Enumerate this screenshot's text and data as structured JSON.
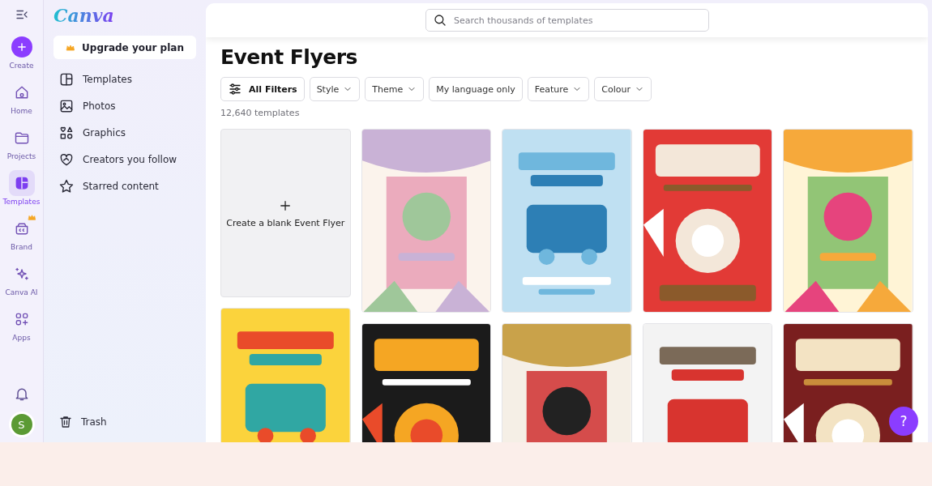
{
  "rail": {
    "items": [
      {
        "label": "Create",
        "kind": "create",
        "selected": false
      },
      {
        "label": "Home",
        "kind": "nav",
        "selected": false
      },
      {
        "label": "Projects",
        "kind": "nav",
        "selected": false
      },
      {
        "label": "Templates",
        "kind": "nav",
        "selected": true
      },
      {
        "label": "Brand",
        "kind": "nav",
        "selected": false,
        "premium": true
      },
      {
        "label": "Canva AI",
        "kind": "nav",
        "selected": false
      },
      {
        "label": "Apps",
        "kind": "nav",
        "selected": false
      }
    ],
    "avatar": "S"
  },
  "side_panel": {
    "logo": "Canva",
    "upgrade": "Upgrade your plan",
    "items": [
      {
        "label": "Templates"
      },
      {
        "label": "Photos"
      },
      {
        "label": "Graphics"
      },
      {
        "label": "Creators you follow"
      },
      {
        "label": "Starred content"
      }
    ],
    "trash": "Trash"
  },
  "search": {
    "placeholder": "Search thousands of templates"
  },
  "title": "Event Flyers",
  "filters": [
    {
      "label": "All Filters",
      "kind": "all",
      "dropdown": false
    },
    {
      "label": "Style",
      "kind": "plain",
      "dropdown": true
    },
    {
      "label": "Theme",
      "kind": "plain",
      "dropdown": true
    },
    {
      "label": "My language only",
      "kind": "plain",
      "dropdown": false
    },
    {
      "label": "Feature",
      "kind": "plain",
      "dropdown": true
    },
    {
      "label": "Colour",
      "kind": "plain",
      "dropdown": true
    }
  ],
  "count": "12,640 templates",
  "grid": [
    [
      {
        "kind": "blank",
        "label": "Create a blank Event Flyer"
      },
      {
        "kind": "picture"
      }
    ],
    [
      {
        "kind": "picture"
      },
      {
        "kind": "picture"
      }
    ],
    [
      {
        "kind": "picture"
      },
      {
        "kind": "picture"
      }
    ],
    [
      {
        "kind": "picture"
      },
      {
        "kind": "picture"
      }
    ],
    [
      {
        "kind": "picture"
      },
      {
        "kind": "picture"
      }
    ]
  ],
  "help": "?"
}
